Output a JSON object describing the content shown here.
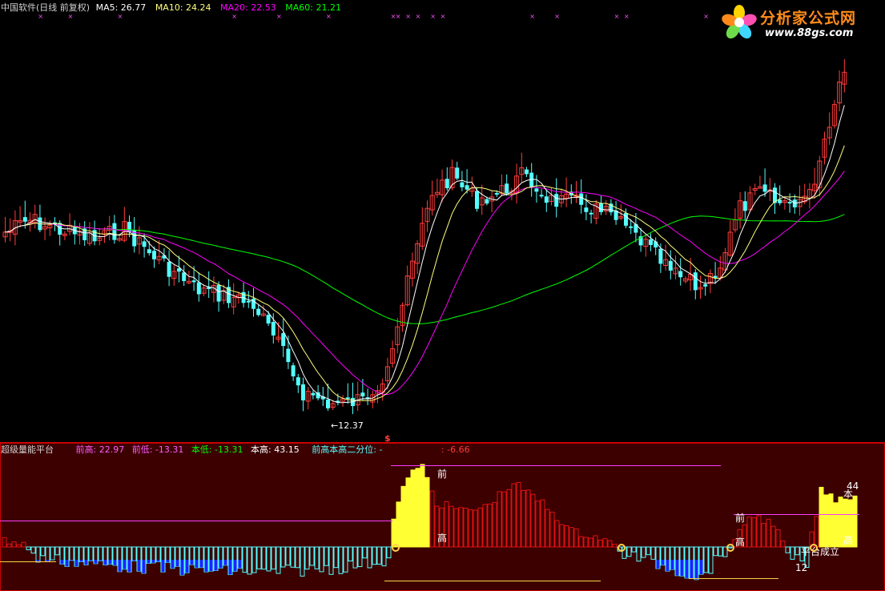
{
  "colors": {
    "background": "#000000",
    "up_candle": "#ff3b3b",
    "down_candle": "#54ffff",
    "ma5": "#ffffff",
    "ma10": "#ffff7f",
    "ma20": "#ff00ff",
    "ma60": "#00ff00",
    "sub_bg": "#3c0000",
    "sub_border": "#cc0000",
    "bar_red": "#e01010",
    "bar_cyan": "#54ffff",
    "bar_yellow": "#ffff33",
    "bar_blue": "#2020ff",
    "line_magenta": "#ff3cff",
    "line_yellow": "#ffd24a"
  },
  "main_legend": {
    "title": "中国软件(日线 前复权)",
    "ma5_label": "MA5: 26.77",
    "ma10_label": "MA10: 24.24",
    "ma20_label": "MA20: 22.53",
    "ma60_label": "MA60: 21.21"
  },
  "sub_legend": {
    "title": "超级量能平台",
    "prev_high": "前高: 22.97",
    "prev_low": "前低: -13.31",
    "cur_low": "本低: -13.31",
    "cur_high": "本高: 43.15",
    "quartile": "前高本高二分位: -",
    "quartile_value": ": -6.66"
  },
  "logo": {
    "name": "分析家公式网",
    "url": "www.88gs.com",
    "icon": "flower-logo-icon"
  },
  "chart_data": [
    {
      "type": "candlestick",
      "title": "中国软件(日线 前复权)",
      "series": [
        {
          "name": "MA5",
          "last": 26.77
        },
        {
          "name": "MA10",
          "last": 24.24
        },
        {
          "name": "MA20",
          "last": 22.53
        },
        {
          "name": "MA60",
          "last": 21.21
        }
      ],
      "annotations": [
        {
          "text": "12.37",
          "type": "low-marker"
        },
        {
          "text": "$",
          "type": "signal-marker"
        }
      ],
      "marker_symbol": "×"
    },
    {
      "type": "bar",
      "title": "超级量能平台",
      "values_reported": {
        "前高": 22.97,
        "前低": -13.31,
        "本低": -13.31,
        "本高": 43.15,
        "前高本高二分位": -6.66
      },
      "annotations": [
        {
          "text": "前"
        },
        {
          "text": "高"
        },
        {
          "text": "前"
        },
        {
          "text": "高"
        },
        {
          "text": "本"
        },
        {
          "text": "高"
        },
        {
          "text": "44"
        },
        {
          "text": "平台成立"
        },
        {
          "text": "12"
        }
      ]
    }
  ]
}
